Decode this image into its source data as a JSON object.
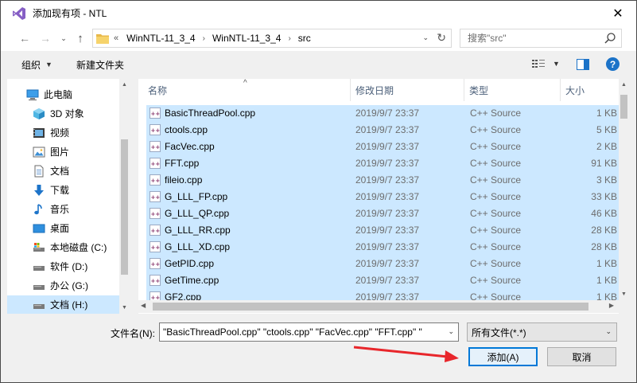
{
  "window": {
    "title": "添加现有项 - NTL",
    "close_glyph": "✕"
  },
  "navbar": {
    "back_glyph": "←",
    "forward_glyph": "→",
    "dropdown_glyph": "⌄",
    "up_glyph": "↑",
    "breadcrumb_lead": "«",
    "breadcrumb": [
      "WinNTL-11_3_4",
      "WinNTL-11_3_4",
      "src"
    ],
    "breadcrumb_sep": "›",
    "refresh_glyph": "↻",
    "search_placeholder": "搜索\"src\""
  },
  "toolbar": {
    "organize_label": "组织",
    "organize_caret": "▼",
    "new_folder_label": "新建文件夹",
    "view_caret": "▼",
    "help_label": "?"
  },
  "sidebar": {
    "items": [
      {
        "label": "此电脑",
        "icon": "computer-icon",
        "selected": false
      },
      {
        "label": "3D 对象",
        "icon": "3d-objects-icon",
        "selected": false
      },
      {
        "label": "视频",
        "icon": "video-icon",
        "selected": false
      },
      {
        "label": "图片",
        "icon": "pictures-icon",
        "selected": false
      },
      {
        "label": "文档",
        "icon": "documents-icon",
        "selected": false
      },
      {
        "label": "下载",
        "icon": "download-icon",
        "selected": false
      },
      {
        "label": "音乐",
        "icon": "music-icon",
        "selected": false
      },
      {
        "label": "桌面",
        "icon": "desktop-icon",
        "selected": false
      },
      {
        "label": "本地磁盘 (C:)",
        "icon": "system-drive-icon",
        "selected": false
      },
      {
        "label": "软件 (D:)",
        "icon": "drive-icon",
        "selected": false
      },
      {
        "label": "办公 (G:)",
        "icon": "drive-icon",
        "selected": false
      },
      {
        "label": "文档 (H:)",
        "icon": "drive-icon",
        "selected": true
      }
    ]
  },
  "files": {
    "columns": {
      "name": "名称",
      "date": "修改日期",
      "type": "类型",
      "size": "大小"
    },
    "sort_glyph": "^",
    "rows": [
      {
        "name": "BasicThreadPool.cpp",
        "date": "2019/9/7 23:37",
        "type": "C++ Source",
        "size": "1 KB"
      },
      {
        "name": "ctools.cpp",
        "date": "2019/9/7 23:37",
        "type": "C++ Source",
        "size": "5 KB"
      },
      {
        "name": "FacVec.cpp",
        "date": "2019/9/7 23:37",
        "type": "C++ Source",
        "size": "2 KB"
      },
      {
        "name": "FFT.cpp",
        "date": "2019/9/7 23:37",
        "type": "C++ Source",
        "size": "91 KB"
      },
      {
        "name": "fileio.cpp",
        "date": "2019/9/7 23:37",
        "type": "C++ Source",
        "size": "3 KB"
      },
      {
        "name": "G_LLL_FP.cpp",
        "date": "2019/9/7 23:37",
        "type": "C++ Source",
        "size": "33 KB"
      },
      {
        "name": "G_LLL_QP.cpp",
        "date": "2019/9/7 23:37",
        "type": "C++ Source",
        "size": "46 KB"
      },
      {
        "name": "G_LLL_RR.cpp",
        "date": "2019/9/7 23:37",
        "type": "C++ Source",
        "size": "28 KB"
      },
      {
        "name": "G_LLL_XD.cpp",
        "date": "2019/9/7 23:37",
        "type": "C++ Source",
        "size": "28 KB"
      },
      {
        "name": "GetPID.cpp",
        "date": "2019/9/7 23:37",
        "type": "C++ Source",
        "size": "1 KB"
      },
      {
        "name": "GetTime.cpp",
        "date": "2019/9/7 23:37",
        "type": "C++ Source",
        "size": "1 KB"
      },
      {
        "name": "GF2.cpp",
        "date": "2019/9/7 23:37",
        "type": "C++ Source",
        "size": "1 KB"
      }
    ]
  },
  "footer": {
    "filename_label": "文件名(N):",
    "filename_value": "\"BasicThreadPool.cpp\" \"ctools.cpp\" \"FacVec.cpp\" \"FFT.cpp\" \"",
    "filter_value": "所有文件(*.*)",
    "add_label": "添加(A)",
    "cancel_label": "取消",
    "dropdown_glyph": "⌄"
  },
  "colors": {
    "selection": "#cce8ff",
    "accent": "#0078d7",
    "annotation_arrow": "#e8262b",
    "vs_purple": "#865fc5"
  }
}
